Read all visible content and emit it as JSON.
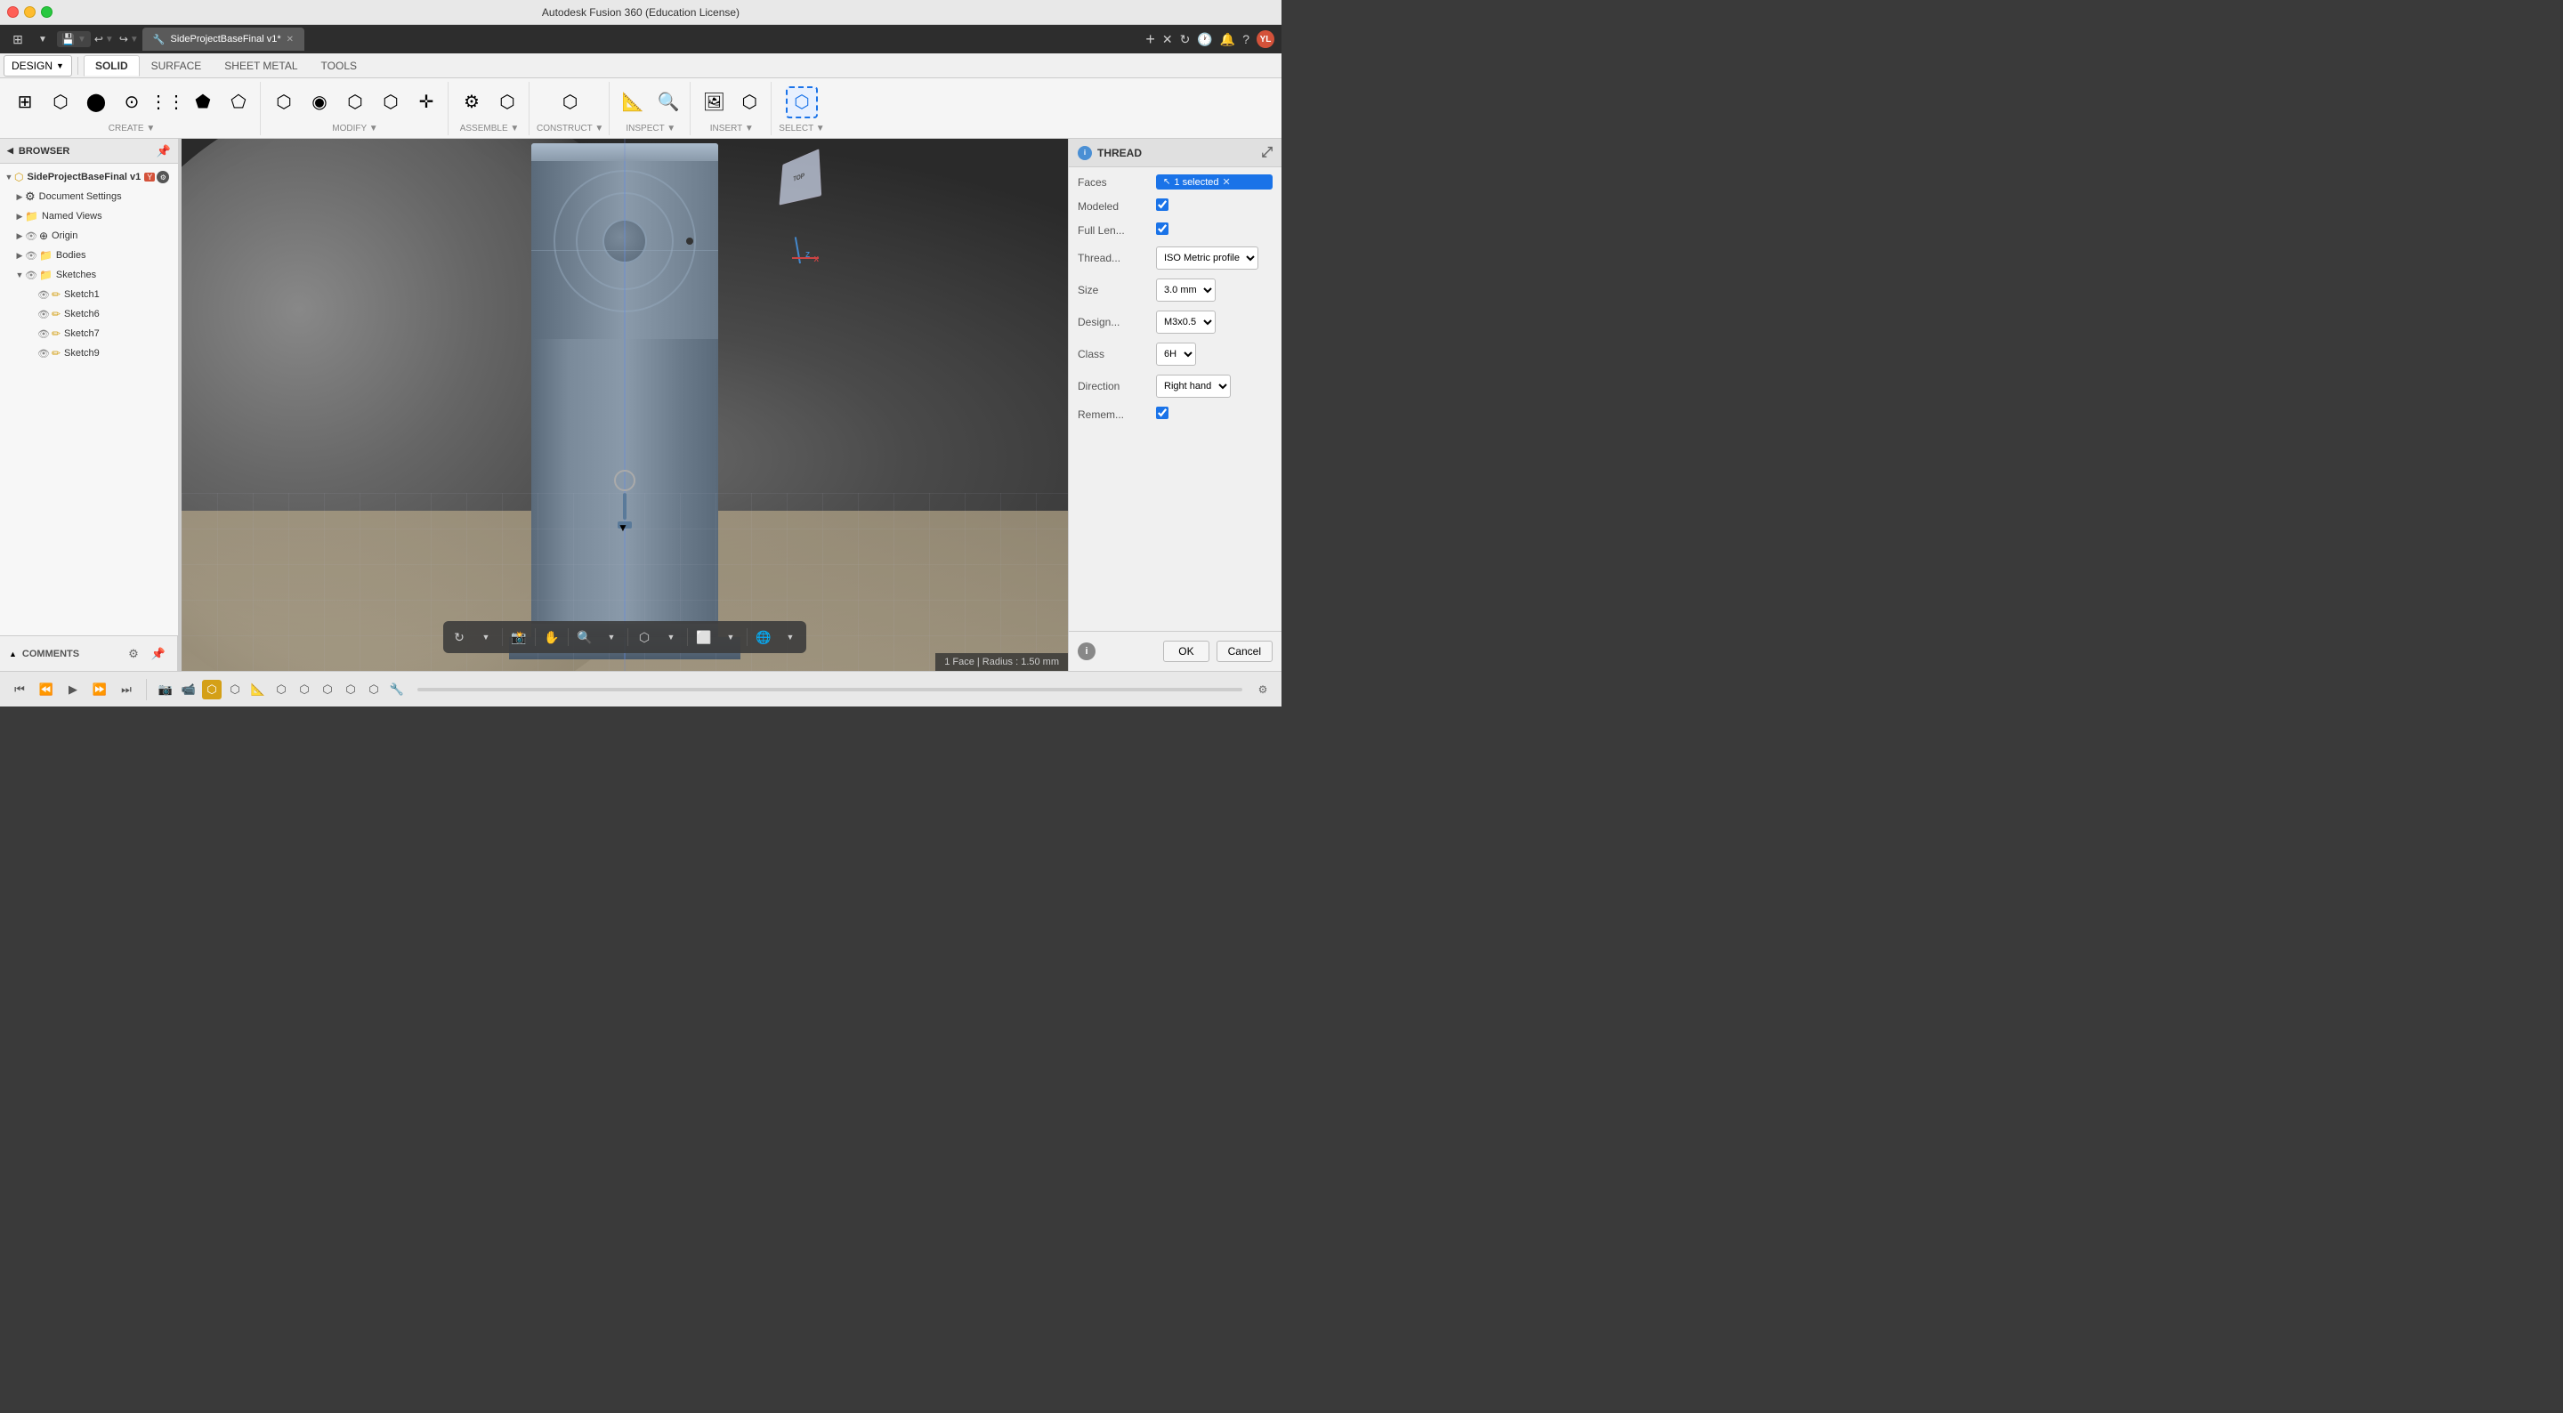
{
  "window": {
    "title": "Autodesk Fusion 360 (Education License)",
    "tab_title": "SideProjectBaseFinal v1*"
  },
  "toolbar": {
    "design_label": "DESIGN",
    "tabs": [
      "SOLID",
      "SURFACE",
      "SHEET METAL",
      "TOOLS"
    ],
    "active_tab": "SOLID",
    "groups": [
      {
        "label": "CREATE",
        "has_dropdown": true
      },
      {
        "label": "MODIFY",
        "has_dropdown": true
      },
      {
        "label": "ASSEMBLE",
        "has_dropdown": true
      },
      {
        "label": "CONSTRUCT",
        "has_dropdown": true
      },
      {
        "label": "INSPECT",
        "has_dropdown": true
      },
      {
        "label": "INSERT",
        "has_dropdown": true
      },
      {
        "label": "SELECT",
        "has_dropdown": true
      }
    ]
  },
  "sidebar": {
    "title": "BROWSER",
    "tree": [
      {
        "level": 0,
        "label": "SideProjectBaseFinal v1",
        "has_children": true,
        "icon": "component",
        "expanded": true,
        "has_eye": false
      },
      {
        "level": 1,
        "label": "Document Settings",
        "has_children": true,
        "icon": "gear",
        "expanded": false
      },
      {
        "level": 1,
        "label": "Named Views",
        "has_children": true,
        "icon": "folder",
        "expanded": false
      },
      {
        "level": 1,
        "label": "Origin",
        "has_children": true,
        "icon": "origin",
        "expanded": false,
        "has_eye": true
      },
      {
        "level": 1,
        "label": "Bodies",
        "has_children": true,
        "icon": "folder",
        "expanded": false,
        "has_eye": true
      },
      {
        "level": 1,
        "label": "Sketches",
        "has_children": true,
        "icon": "folder",
        "expanded": true,
        "has_eye": true
      },
      {
        "level": 2,
        "label": "Sketch1",
        "icon": "sketch",
        "has_eye": true
      },
      {
        "level": 2,
        "label": "Sketch6",
        "icon": "sketch",
        "has_eye": true
      },
      {
        "level": 2,
        "label": "Sketch7",
        "icon": "sketch",
        "has_eye": true
      },
      {
        "level": 2,
        "label": "Sketch9",
        "icon": "sketch",
        "has_eye": true
      }
    ]
  },
  "thread_panel": {
    "title": "THREAD",
    "fields": {
      "faces_label": "Faces",
      "faces_value": "1 selected",
      "modeled_label": "Modeled",
      "modeled_checked": true,
      "full_length_label": "Full Len...",
      "full_length_checked": true,
      "thread_type_label": "Thread...",
      "thread_type_value": "ISO Metric profile",
      "size_label": "Size",
      "size_value": "3.0 mm",
      "designation_label": "Design...",
      "designation_value": "M3x0.5",
      "class_label": "Class",
      "class_value": "6H",
      "direction_label": "Direction",
      "direction_value": "Right hand",
      "remember_label": "Remem...",
      "remember_checked": true
    },
    "ok_label": "OK",
    "cancel_label": "Cancel"
  },
  "status_bar": {
    "text": "1 Face | Radius : 1.50 mm"
  },
  "comments": {
    "label": "COMMENTS"
  },
  "playback": {
    "icons": [
      "skip_start",
      "prev",
      "play",
      "next",
      "skip_end"
    ]
  }
}
